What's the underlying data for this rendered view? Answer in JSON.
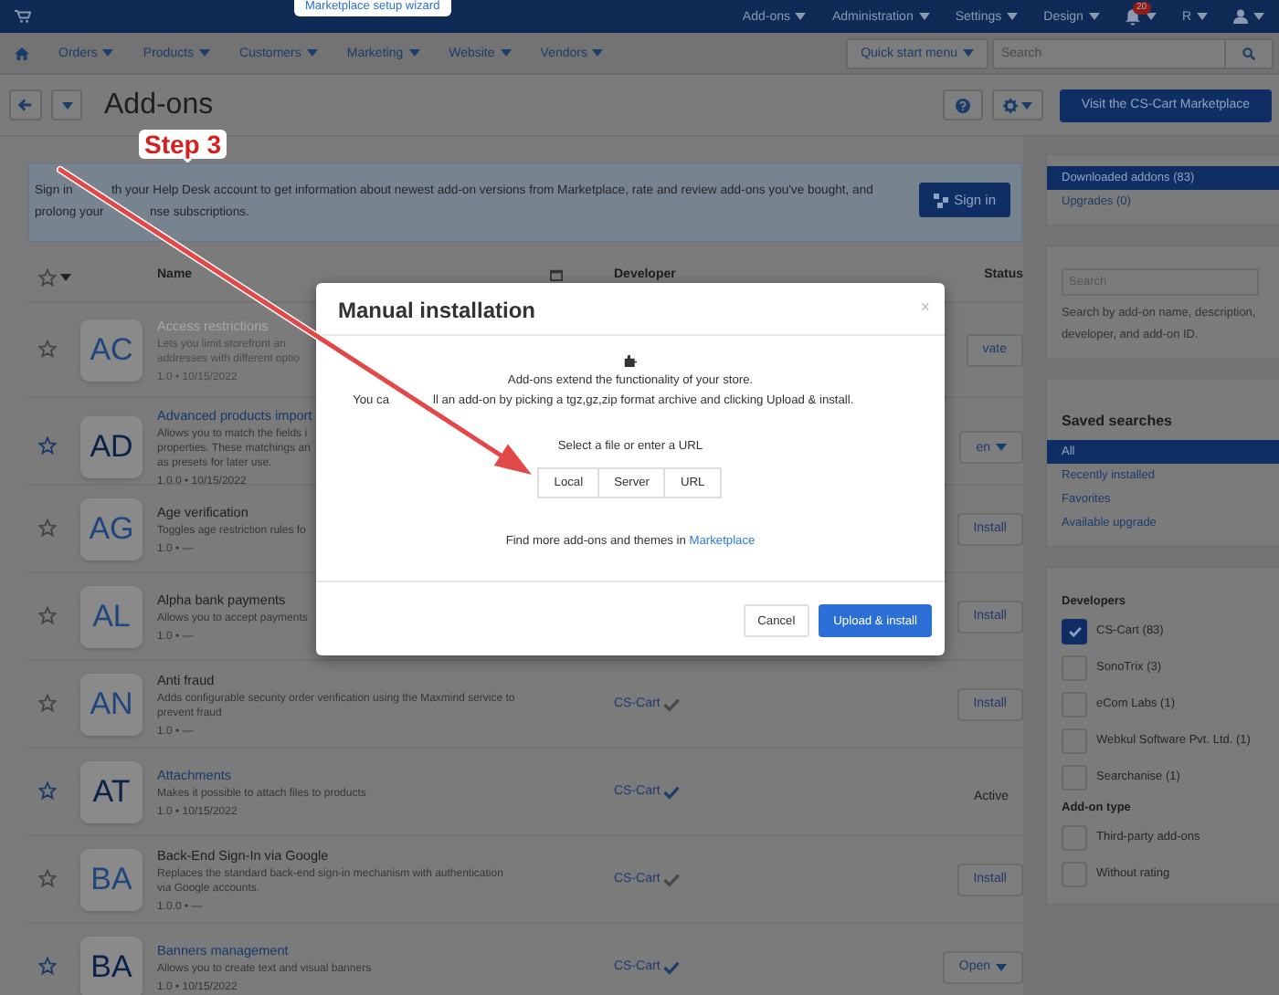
{
  "top_bar": {
    "wizard_tip": "Marketplace setup wizard",
    "menus": [
      "Add-ons",
      "Administration",
      "Settings",
      "Design"
    ],
    "notification_count": "20",
    "user_menu": "R"
  },
  "nav": {
    "items": [
      "Orders",
      "Products",
      "Customers",
      "Marketing",
      "Website",
      "Vendors"
    ],
    "quick_start": "Quick start menu",
    "search": {
      "placeholder": "Search"
    }
  },
  "title_bar": {
    "title": "Add-ons",
    "marketplace_button": "Visit the CS-Cart Marketplace"
  },
  "banner": {
    "lines": [
      [
        "Sign in",
        "th your Help Desk account to get information about newest add-on versions from Marketplace, rate and review add-ons you've bought, and"
      ],
      [
        "prolong your",
        "nse subscriptions."
      ]
    ],
    "button": "Sign in"
  },
  "table": {
    "columns": [
      "Name",
      "Developer",
      "Status"
    ],
    "rows": [
      {
        "initials": "AC",
        "name": "Access restrictions",
        "description_lines": [
          "Lets you limit storefront an",
          "addresses with different optio"
        ],
        "meta": "1.0 • 10/15/2022",
        "installed": false,
        "disabled": true,
        "action": {
          "kind": "button",
          "label": "vate"
        }
      },
      {
        "initials": "AD",
        "name": "Advanced products import",
        "description_lines": [
          "Allows you to match the fields i",
          "properties. These matchings an",
          "as presets for later use."
        ],
        "meta": "1.0.0 • 10/15/2022",
        "installed": true,
        "disabled": false,
        "action": {
          "kind": "dropdown",
          "label": "en"
        }
      },
      {
        "initials": "AG",
        "name": "Age verification",
        "description_lines": [
          "Toggles age restriction rules fo"
        ],
        "meta": "1.0 • —",
        "installed": false,
        "disabled": false,
        "action": {
          "kind": "button",
          "label": "Install"
        }
      },
      {
        "initials": "AL",
        "name": "Alpha bank payments",
        "description_lines": [
          "Allows you to accept payments"
        ],
        "meta": "1.0 • —",
        "installed": false,
        "disabled": false,
        "action": {
          "kind": "button",
          "label": "Install"
        }
      },
      {
        "initials": "AN",
        "name": "Anti fraud",
        "description_lines": [
          "Adds configurable security order verification using the Maxmind service to",
          "prevent fraud"
        ],
        "meta": "1.0 • —",
        "developer": "CS-Cart",
        "installed": false,
        "disabled": false,
        "action": {
          "kind": "button",
          "label": "Install"
        }
      },
      {
        "initials": "AT",
        "name": "Attachments",
        "description_lines": [
          "Makes it possible to attach files to products"
        ],
        "meta": "1.0 • 10/15/2022",
        "developer": "CS-Cart",
        "installed": true,
        "disabled": false,
        "action": {
          "kind": "status",
          "label": "Active"
        }
      },
      {
        "initials": "BA",
        "name": "Back-End Sign-In via Google",
        "description_lines": [
          "Replaces the standard back-end sign-in mechanism with authentication",
          "via Google accounts."
        ],
        "meta": "1.0.0 • —",
        "developer": "CS-Cart",
        "installed": false,
        "disabled": false,
        "action": {
          "kind": "button",
          "label": "Install"
        }
      },
      {
        "initials": "BA",
        "name": "Banners management",
        "description_lines": [
          "Allows you to create text and visual banners"
        ],
        "meta": "1.0 • 10/15/2022",
        "developer": "CS-Cart",
        "installed": true,
        "disabled": false,
        "action": {
          "kind": "dropdown",
          "label": "Open"
        }
      }
    ]
  },
  "sidebar": {
    "views": [
      {
        "label": "Downloaded addons (83)",
        "selected": true
      },
      {
        "label": "Upgrades (0)",
        "selected": false
      }
    ],
    "search": {
      "placeholder": "Search",
      "hint": "Search by add-on name, description, developer, and add-on ID."
    },
    "saved_searches": {
      "title": "Saved searches",
      "items": [
        {
          "label": "All",
          "selected": true
        },
        {
          "label": "Recently installed",
          "selected": false
        },
        {
          "label": "Favorites",
          "selected": false
        },
        {
          "label": "Available upgrade",
          "selected": false
        }
      ]
    },
    "filters": [
      {
        "title": "Developers",
        "options": [
          {
            "label": "CS-Cart (83)",
            "checked": true
          },
          {
            "label": "SonoTrix (3)",
            "checked": false
          },
          {
            "label": "eCom Labs (1)",
            "checked": false
          },
          {
            "label": "Webkul Software Pvt. Ltd. (1)",
            "checked": false
          },
          {
            "label": "Searchanise (1)",
            "checked": false
          }
        ]
      },
      {
        "title": "Add-on type",
        "options": [
          {
            "label": "Third-party add-ons",
            "checked": false
          },
          {
            "label": "Without rating",
            "checked": false
          }
        ]
      }
    ]
  },
  "modal": {
    "title": "Manual installation",
    "close": "×",
    "intro": "Add-ons extend the functionality of your store.",
    "instructions_parts": [
      "You ca",
      "ll an add-on by picking a tgz,gz,zip format archive and clicking Upload & install."
    ],
    "source_label": "Select a file or enter a URL",
    "sources": [
      "Local",
      "Server",
      "URL"
    ],
    "more_text": "Find more add-ons and themes in",
    "more_link": "Marketplace",
    "buttons": [
      {
        "label": "Cancel",
        "kind": "secondary"
      },
      {
        "label": "Upload & install",
        "kind": "primary"
      }
    ]
  },
  "annotation": {
    "label": "Step 3"
  }
}
